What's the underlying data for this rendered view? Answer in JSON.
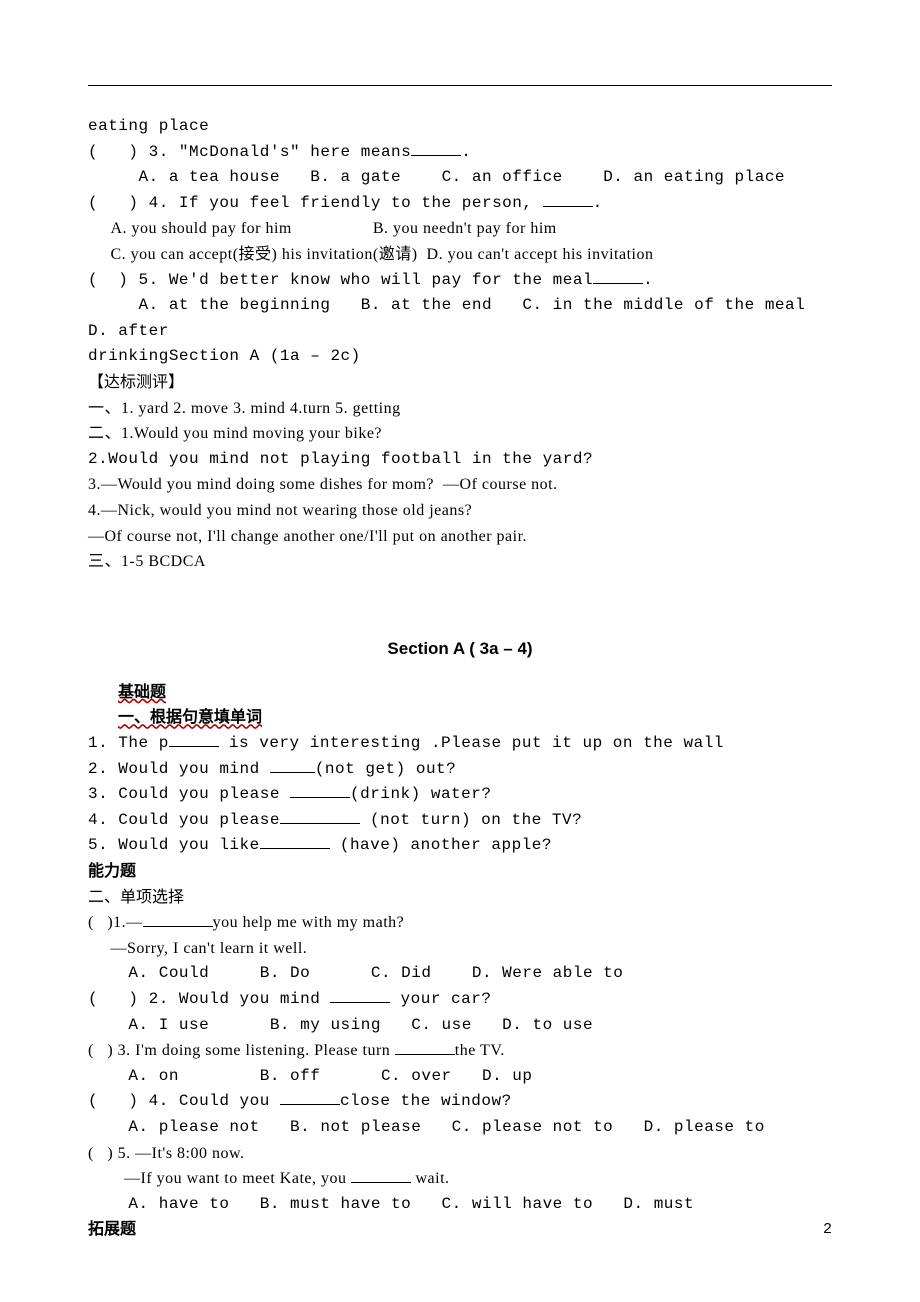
{
  "top": {
    "l1": "eating place",
    "q3": "(   ) 3. \"McDonald's\" here means",
    "q3a": "     A. a tea house   B. a gate    C. an office    D. an eating place",
    "q4": "(   ) 4. If you feel friendly to the person, ",
    "q4ab": "     A. you should pay for him                  B. you needn't pay for him",
    "q4cd": "     C. you can accept(接受) his invitation(邀请)  D. you can't accept his invitation",
    "q5": "(  ) 5. We'd better know who will pay for the meal",
    "q5a": "     A. at the beginning   B. at the end   C. in the middle of the meal   D. after",
    "q5b": "drinkingSection A (1a – 2c)"
  },
  "ans": {
    "title": "【达标测评】",
    "l1": "一、1. yard 2. move 3. mind 4.turn 5. getting",
    "l2": "二、1.Would you mind moving your bike?",
    "l3": "2.Would you mind not playing football in the yard?",
    "l4": "3.—Would you mind doing some dishes for mom?  —Of course not.",
    "l5": "4.—Nick, would you mind not wearing those old jeans?",
    "l6": "—Of course not, I'll change another one/I'll put on another pair.",
    "l7": "三、1-5 BCDCA"
  },
  "sec": {
    "title": "Section A ( 3a – 4)",
    "base": "基础题",
    "fill": "一、根据句意填单词",
    "f1a": "1. The p",
    "f1b": " is very interesting .Please put it up on the wall",
    "f2a": "2. Would you mind ",
    "f2b": "(not get) out?",
    "f3a": "3. Could you please ",
    "f3b": "(drink) water?",
    "f4a": "4. Could you please",
    "f4b": " (not turn) on the TV?",
    "f5a": "5. Would you like",
    "f5b": " (have) another apple?",
    "ability": "能力题",
    "mc": "二、单项选择",
    "mq1a": "(   )1.—",
    "mq1b": "you help me with my math?",
    "mq1c": "     —Sorry, I can't learn it well.",
    "mq1d": "    A. Could     B. Do      C. Did    D. Were able to",
    "mq2a": "(   ) 2. Would you mind ",
    "mq2b": " your car?",
    "mq2c": "    A. I use      B. my using   C. use   D. to use",
    "mq3a": "(   ) 3. I'm doing some listening. Please turn ",
    "mq3b": "the TV.",
    "mq3c": "    A. on        B. off      C. over   D. up",
    "mq4a": "(   ) 4. Could you ",
    "mq4b": "close the window?",
    "mq4c": "    A. please not   B. not please   C. please not to   D. please to",
    "mq5a": "(   ) 5. —It's 8:00 now.",
    "mq5b": "        —If you want to meet Kate, you ",
    "mq5c": " wait.",
    "mq5d": "    A. have to   B. must have to   C. will have to   D. must",
    "ext": "拓展题"
  },
  "page": "2"
}
